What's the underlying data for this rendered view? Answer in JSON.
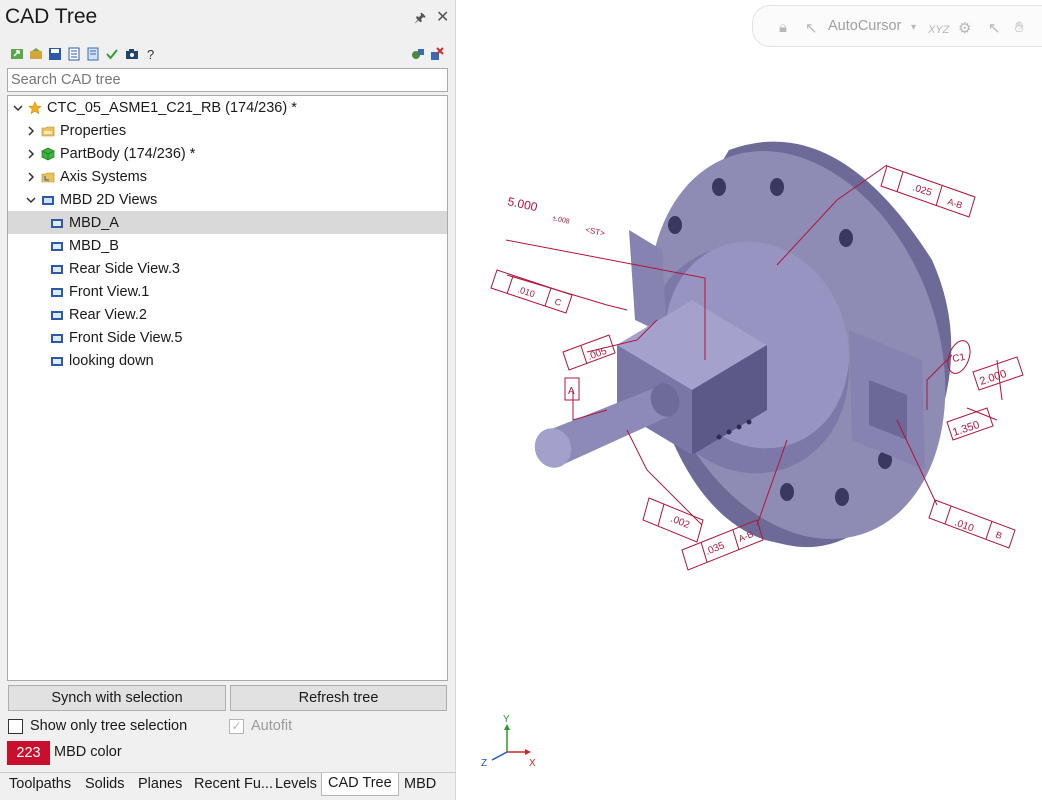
{
  "panel": {
    "title": "CAD Tree",
    "search_placeholder": "Search CAD tree",
    "toolbar_icons": [
      "export-icon",
      "import-icon",
      "save-icon",
      "document-icon",
      "list-icon",
      "checkmark-icon",
      "camera-icon",
      "help-icon",
      "collapse-icon",
      "delete-icon"
    ],
    "tree": {
      "root": "CTC_05_ASME1_C21_RB (174/236) *",
      "items": [
        {
          "label": "Properties"
        },
        {
          "label": "PartBody (174/236) *"
        },
        {
          "label": "Axis Systems"
        },
        {
          "label": "MBD 2D Views"
        }
      ],
      "views": [
        "MBD_A",
        "MBD_B",
        "Rear Side View.3",
        "Front View.1",
        "Rear View.2",
        "Front Side View.5",
        "looking down"
      ],
      "selected_view": "MBD_A"
    },
    "buttons": {
      "synch": "Synch with selection",
      "refresh": "Refresh tree"
    },
    "checkboxes": {
      "show_only": {
        "label": "Show only tree selection",
        "checked": false
      },
      "autofit": {
        "label": "Autofit",
        "checked": true,
        "disabled": true
      }
    },
    "mbd": {
      "value": "223",
      "label": "MBD color",
      "color": "#c8102e"
    },
    "tabs": [
      "Toolpaths",
      "Solids",
      "Planes",
      "Recent Fu...",
      "Levels",
      "CAD Tree",
      "MBD"
    ],
    "active_tab": "CAD Tree"
  },
  "viewport": {
    "toolbar": {
      "autocursor": "AutoCursor",
      "xyz": "XYZ"
    },
    "axes": {
      "x": "X",
      "y": "Y",
      "z": "Z"
    },
    "annotations": {
      "dim_5000": "5.000",
      "tol_small": "±.008",
      "st": "<ST>",
      "dim_2000": "2.000",
      "dim_1350": "1.350",
      "datum_a": "A",
      "c1": "C1",
      "fcf_025": ".025",
      "fcf_025_ref": "A-B",
      "fcf_005": ".005",
      "fcf_002": ".002",
      "fcf_035": ".035",
      "fcf_035_ref": "A-B",
      "fcf_010": ".010",
      "fcf_010_ref": "B",
      "fcf_010b": ".010",
      "fcf_010b_ref": "C"
    },
    "colors": {
      "mbd": "#b0153a",
      "part": "#8e8bb5"
    }
  }
}
